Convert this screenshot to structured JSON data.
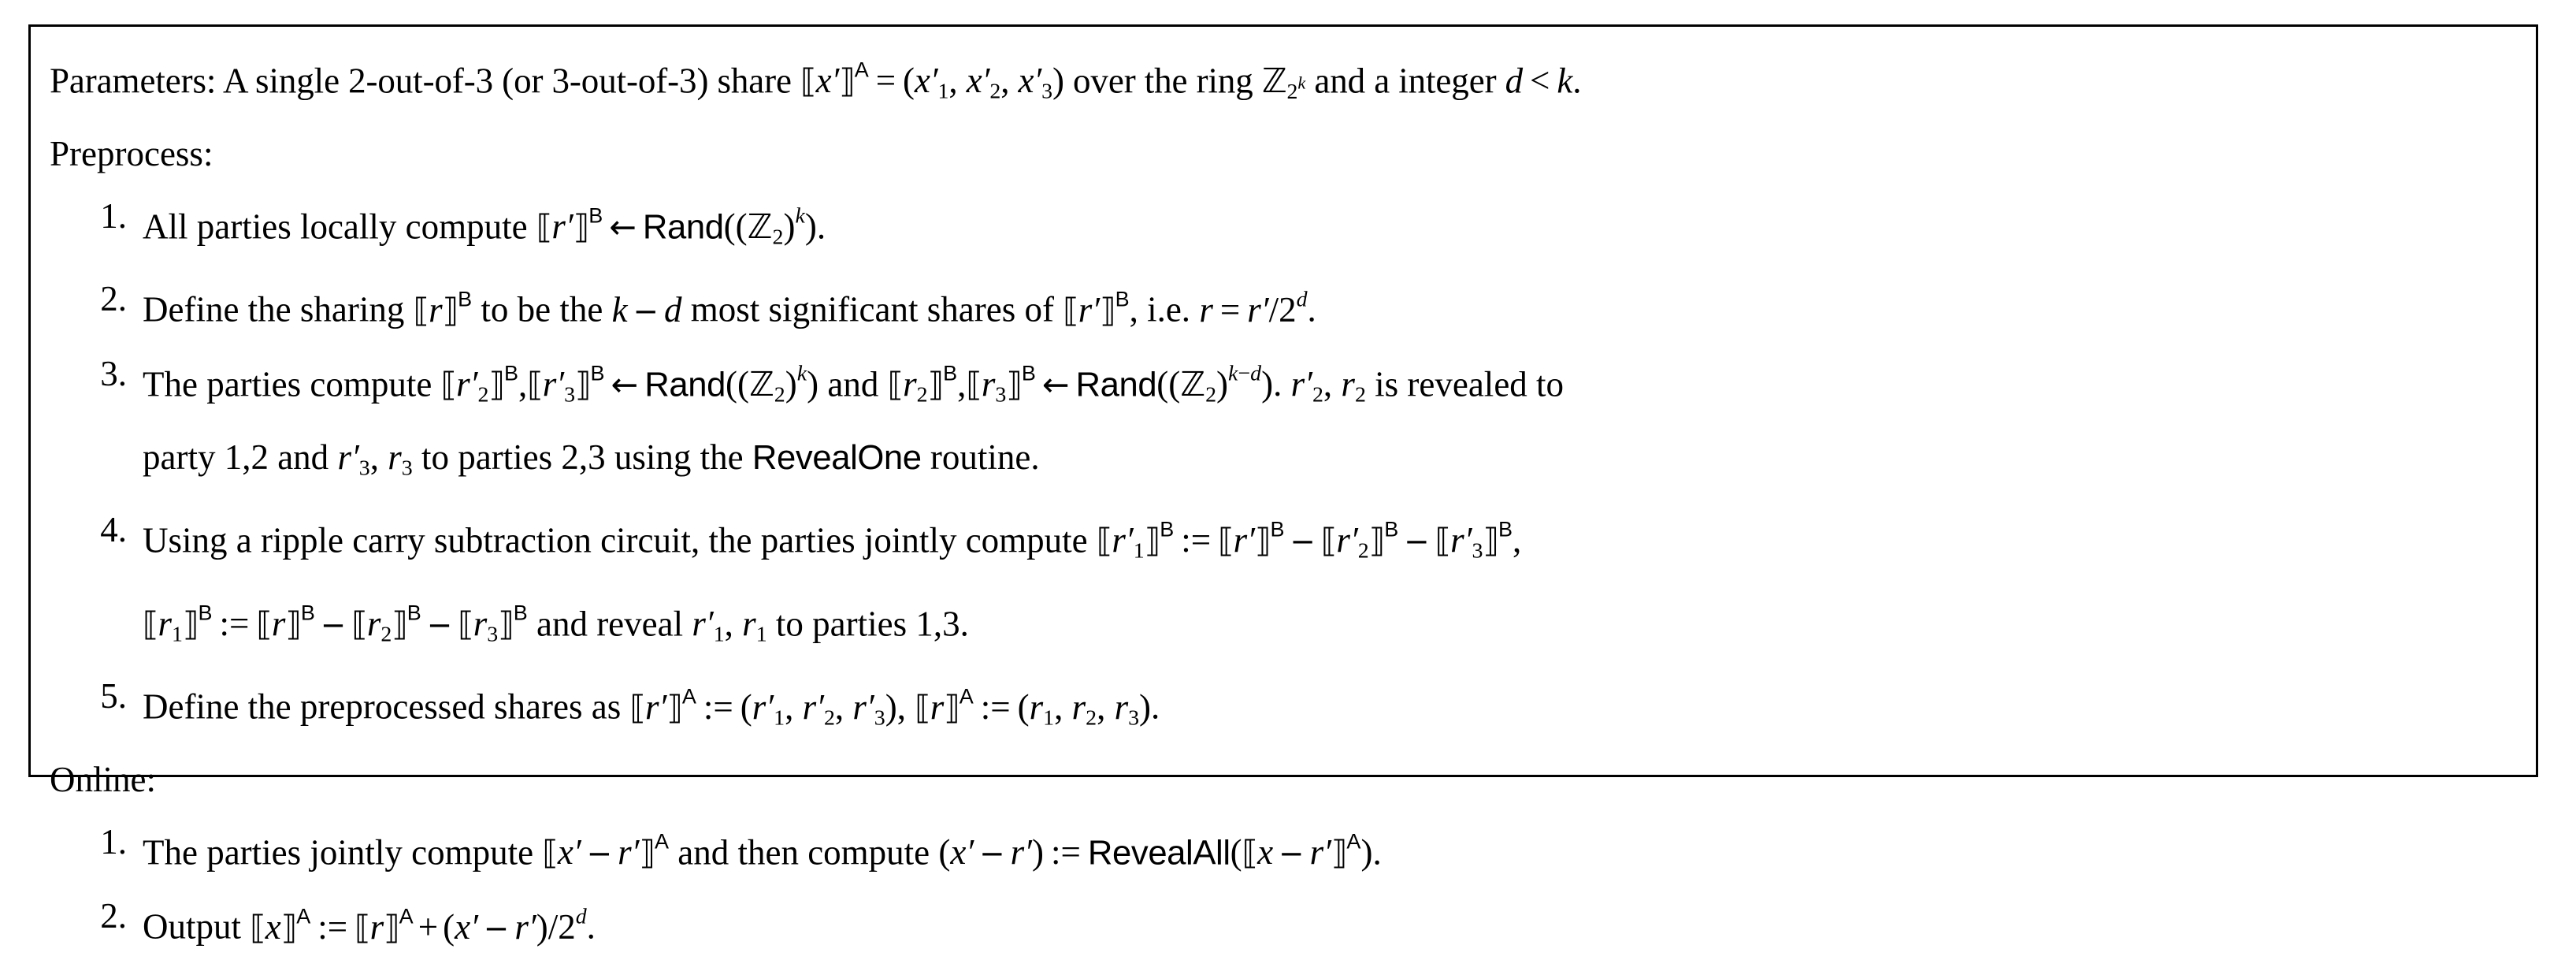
{
  "document": {
    "type": "algorithm-box",
    "border_color": "#000000",
    "background_color": "#ffffff",
    "text_color": "#000000"
  },
  "headings": {
    "parameters_label": "Parameters:",
    "preprocess_label": "Preprocess:",
    "online_label": "Online:"
  },
  "parameters": {
    "text_before_share": "A single 2-out-of-3 (or 3-out-of-3) share",
    "share_symbol": "⟦x'⟧ᴬ",
    "equals": "=",
    "share_tuple": "(x'₁, x'₂, x'₃)",
    "text_mid": "over the ring",
    "ring": "ℤ₂^k",
    "text_after_ring": "and a integer",
    "condition": "d < k.",
    "full_text": "Parameters: A single 2-out-of-3 (or 3-out-of-3) share ⟦x'⟧ᴬ = (x'₁, x'₂, x'₃) over the ring ℤ_{2^k} and a integer d < k."
  },
  "preprocess_steps": [
    {
      "number": "1.",
      "full_text": "All parties locally compute ⟦r'⟧ᴮ ← Rand((ℤ₂)^k).",
      "segments": {
        "s1": "All parties locally compute",
        "s2": "Rand",
        "s3": "."
      }
    },
    {
      "number": "2.",
      "full_text": "Define the sharing ⟦r⟧ᴮ to be the k − d most significant shares of ⟦r'⟧ᴮ, i.e. r = r'/2^d.",
      "segments": {
        "s1": "Define the sharing",
        "s2": "to be the",
        "s3": "most significant shares of",
        "s4": ", i.e.",
        "s5": "."
      }
    },
    {
      "number": "3.",
      "full_text": "The parties compute ⟦r'₂⟧ᴮ, ⟦r'₃⟧ᴮ ← Rand((ℤ₂)^k) and ⟦r₂⟧ᴮ, ⟦r₃⟧ᴮ ← Rand((ℤ₂)^{k−d}). r'₂, r₂ is revealed to party 1,2 and r'₃, r₃ to parties 2,3 using the RevealOne routine.",
      "segments": {
        "s1": "The parties compute",
        "s2": "Rand",
        "s3": "and",
        "s4": "Rand",
        "s5": "is revealed to",
        "s6": "party 1,2 and",
        "s7": "to parties 2,3 using the",
        "s8": "RevealOne",
        "s9": "routine."
      }
    },
    {
      "number": "4.",
      "full_text": "Using a ripple carry subtraction circuit, the parties jointly compute ⟦r'₁⟧ᴮ := ⟦r'⟧ᴮ − ⟦r'₂⟧ᴮ − ⟦r'₃⟧ᴮ, ⟦r₁⟧ᴮ := ⟦r⟧ᴮ − ⟦r₂⟧ᴮ − ⟦r₃⟧ᴮ and reveal r'₁, r₁ to parties 1,3.",
      "segments": {
        "s1": "Using a ripple carry subtraction circuit, the parties jointly compute",
        "s2": "and reveal",
        "s3": "to parties 1,3."
      }
    },
    {
      "number": "5.",
      "full_text": "Define the preprocessed shares as ⟦r'⟧ᴬ := (r'₁, r'₂, r'₃), ⟦r⟧ᴬ := (r₁, r₂, r₃).",
      "segments": {
        "s1": "Define the preprocessed shares as",
        "s2": "."
      }
    }
  ],
  "online_steps": [
    {
      "number": "1.",
      "full_text": "The parties jointly compute ⟦x' − r'⟧ᴬ and then compute (x' − r') := RevealAll(⟦x − r'⟧ᴬ).",
      "segments": {
        "s1": "The parties jointly compute",
        "s2": "and then compute",
        "s3": "RevealAll",
        "s4": "."
      }
    },
    {
      "number": "2.",
      "full_text": "Output ⟦x⟧ᴬ := ⟦r⟧ᴬ + (x' − r')/2^d.",
      "segments": {
        "s1": "Output",
        "s2": "."
      }
    }
  ],
  "symbols": {
    "left_dbracket": "⟦",
    "right_dbracket": "⟧",
    "left_arrow": "←",
    "minus": "−",
    "assign": ":=",
    "equals": "=",
    "less_than": "<",
    "plus": "+",
    "blackboard_Z": "ℤ",
    "superscript_A": "A",
    "superscript_B": "B"
  }
}
